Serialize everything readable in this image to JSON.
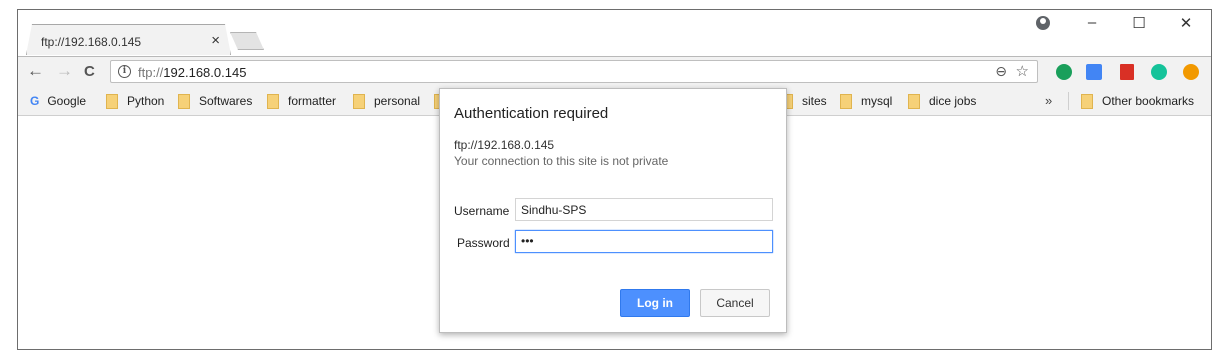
{
  "tab": {
    "title": "ftp://192.168.0.145",
    "close_glyph": "×"
  },
  "window_controls": {
    "minimize": "–",
    "maximize": "☐",
    "close": "✕"
  },
  "toolbar": {
    "back": "←",
    "forward": "→",
    "reload": "C",
    "url_scheme": "ftp://",
    "url_host": "192.168.0.145",
    "zoom_glyph": "⊖",
    "star_glyph": "☆"
  },
  "extensions": [
    {
      "name": "green-extension-icon",
      "color": "#1a9f5b"
    },
    {
      "name": "translate-extension-icon",
      "color": "#4285f4"
    },
    {
      "name": "red-book-extension-icon",
      "color": "#d93025"
    },
    {
      "name": "grammarly-extension-icon",
      "color": "#15c39a"
    },
    {
      "name": "orange-alert-extension-icon",
      "color": "#f29900"
    }
  ],
  "bookmarks": {
    "items": [
      "Google",
      "Python",
      "Softwares",
      "formatter",
      "personal",
      "sites",
      "mysql",
      "dice jobs"
    ],
    "overflow": "»",
    "other": "Other bookmarks"
  },
  "dialog": {
    "title": "Authentication required",
    "origin": "ftp://192.168.0.145",
    "warning": "Your connection to this site is not private",
    "username_label": "Username",
    "username_value": "Sindhu-SPS",
    "password_label": "Password",
    "password_mask": "•••",
    "login_label": "Log in",
    "cancel_label": "Cancel"
  },
  "colors": {
    "accent": "#4d90fe",
    "folder": "#f6d178"
  }
}
